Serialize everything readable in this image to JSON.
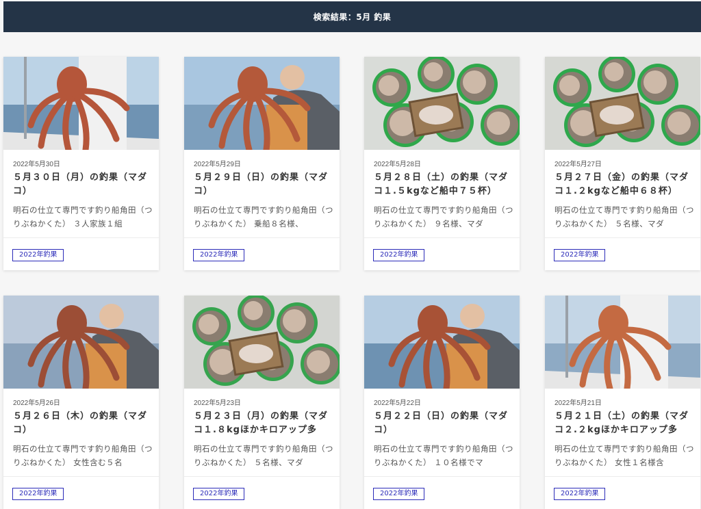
{
  "header": {
    "title": "検索結果：5月 釣果"
  },
  "cards": [
    {
      "date": "2022年5月30日",
      "title": "５月３０日（月）の釣果（マダコ）",
      "excerpt": "明石の仕立て専門です釣り船角田（つりぶねかくた） ３人家族１組",
      "tag": "2022年釣果",
      "image": {
        "icon": "octopus-held-on-boat",
        "sky": "#bcd3e6",
        "sea": "#6f93b3",
        "accent": "#b5563a"
      }
    },
    {
      "date": "2022年5月29日",
      "title": "５月２９日（日）の釣果（マダコ）",
      "excerpt": "明石の仕立て専門です釣り船角田（つりぶねかくた） 乗船８名様、",
      "tag": "2022年釣果",
      "image": {
        "icon": "angler-holding-octopus",
        "sky": "#a9c6e0",
        "sea": "#7d9fbd",
        "accent": "#b4593a"
      }
    },
    {
      "date": "2022年5月28日",
      "title": "５月２８日（土）の釣果（マダコ１.５kgなど船中７５杯）",
      "excerpt": "明石の仕立て専門です釣り船角田（つりぶねかくた） ９名様、マダ",
      "tag": "2022年釣果",
      "image": {
        "icon": "buckets-of-octopus",
        "sky": "#d9dcd8",
        "sea": "#cfd3cf",
        "accent": "#2fa84a"
      }
    },
    {
      "date": "2022年5月27日",
      "title": "５月２７日（金）の釣果（マダコ１.２kgなど船中６８杯）",
      "excerpt": "明石の仕立て専門です釣り船角田（つりぶねかくた） ５名様、マダ",
      "tag": "2022年釣果",
      "image": {
        "icon": "buckets-of-octopus",
        "sky": "#d6d8d3",
        "sea": "#c9ccc7",
        "accent": "#2ea84c"
      }
    },
    {
      "date": "2022年5月26日",
      "title": "５月２６日（木）の釣果（マダコ）",
      "excerpt": "明石の仕立て専門です釣り船角田（つりぶねかくた） 女性含む５名",
      "tag": "2022年釣果",
      "image": {
        "icon": "angler-holding-octopus",
        "sky": "#bccadb",
        "sea": "#8aa2bb",
        "accent": "#9c4e36"
      }
    },
    {
      "date": "2022年5月23日",
      "title": "５月２３日（月）の釣果（マダコ１.８kgほかキロアップ多",
      "excerpt": "明石の仕立て専門です釣り船角田（つりぶねかくた） ５名様、マダ",
      "tag": "2022年釣果",
      "image": {
        "icon": "buckets-of-octopus",
        "sky": "#d3d5d1",
        "sea": "#c4c7c2",
        "accent": "#36a44e"
      }
    },
    {
      "date": "2022年5月22日",
      "title": "５月２２日（日）の釣果（マダコ）",
      "excerpt": "明石の仕立て専門です釣り船角田（つりぶねかくた） １０名様でマ",
      "tag": "2022年釣果",
      "image": {
        "icon": "angler-holding-octopus",
        "sky": "#b6cde2",
        "sea": "#6e92b2",
        "accent": "#a85236"
      }
    },
    {
      "date": "2022年5月21日",
      "title": "５月２１日（土）の釣果（マダコ２.２kgほかキロアップ多",
      "excerpt": "明石の仕立て専門です釣り船角田（つりぶねかくた） 女性１名様含",
      "tag": "2022年釣果",
      "image": {
        "icon": "octopus-held-on-boat",
        "sky": "#c4d6e6",
        "sea": "#8eaac4",
        "accent": "#c46a42"
      }
    }
  ]
}
